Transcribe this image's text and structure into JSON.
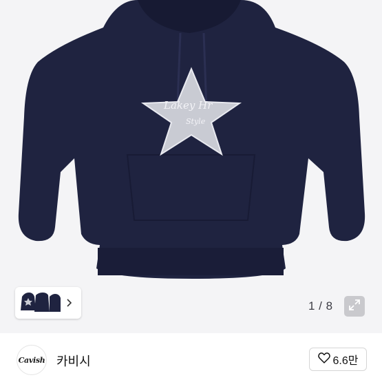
{
  "gallery": {
    "current_page": "1",
    "total_pages": "8",
    "counter_text": "1 / 8",
    "product_image": "navy-star-hoodie",
    "thumbnails": [
      "hoodie-front-thumb",
      "hoodie-back-thumb",
      "hoodie-side-thumb"
    ],
    "thumbnail_next_icon": "chevron-right-icon",
    "expand_icon": "expand-arrows-icon",
    "background_color": "#f4f4f6",
    "hoodie_color": "#1f2340"
  },
  "seller": {
    "logo_text": "Cavish",
    "name": "카비시"
  },
  "like": {
    "icon": "heart-outline-icon",
    "count": "6.6만"
  }
}
